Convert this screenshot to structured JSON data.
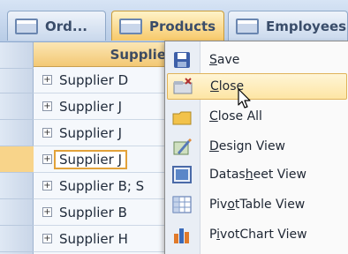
{
  "tabs": [
    {
      "label": "Ord...",
      "active": false
    },
    {
      "label": "Products",
      "active": true
    },
    {
      "label": "Employees",
      "active": false
    }
  ],
  "datasheet": {
    "column_header": "Supplie",
    "rows": [
      "Supplier D",
      "Supplier J",
      "Supplier J",
      "Supplier J",
      "Supplier B; S",
      "Supplier B",
      "Supplier H"
    ],
    "current_row_index": 3
  },
  "context_menu": {
    "items": [
      {
        "label": "Save",
        "access_key_index": 0,
        "icon": "save-icon"
      },
      {
        "label": "Close",
        "access_key_index": 0,
        "icon": "close-tab-icon",
        "highlighted": true
      },
      {
        "label": "Close All",
        "access_key_index": 0,
        "icon": "close-all-icon"
      },
      {
        "label": "Design View",
        "access_key_index": 0,
        "icon": "design-view-icon"
      },
      {
        "label": "Datasheet View",
        "access_key_index": 5,
        "icon": "datasheet-view-icon"
      },
      {
        "label": "PivotTable View",
        "access_key_index": 3,
        "icon": "pivottable-view-icon"
      },
      {
        "label": "PivotChart View",
        "access_key_index": 1,
        "icon": "pivotchart-view-icon"
      }
    ]
  },
  "colors": {
    "active_tab": "#f7c96a",
    "menu_highlight": "#fde5a4",
    "current_row_border": "#e2a23a"
  }
}
